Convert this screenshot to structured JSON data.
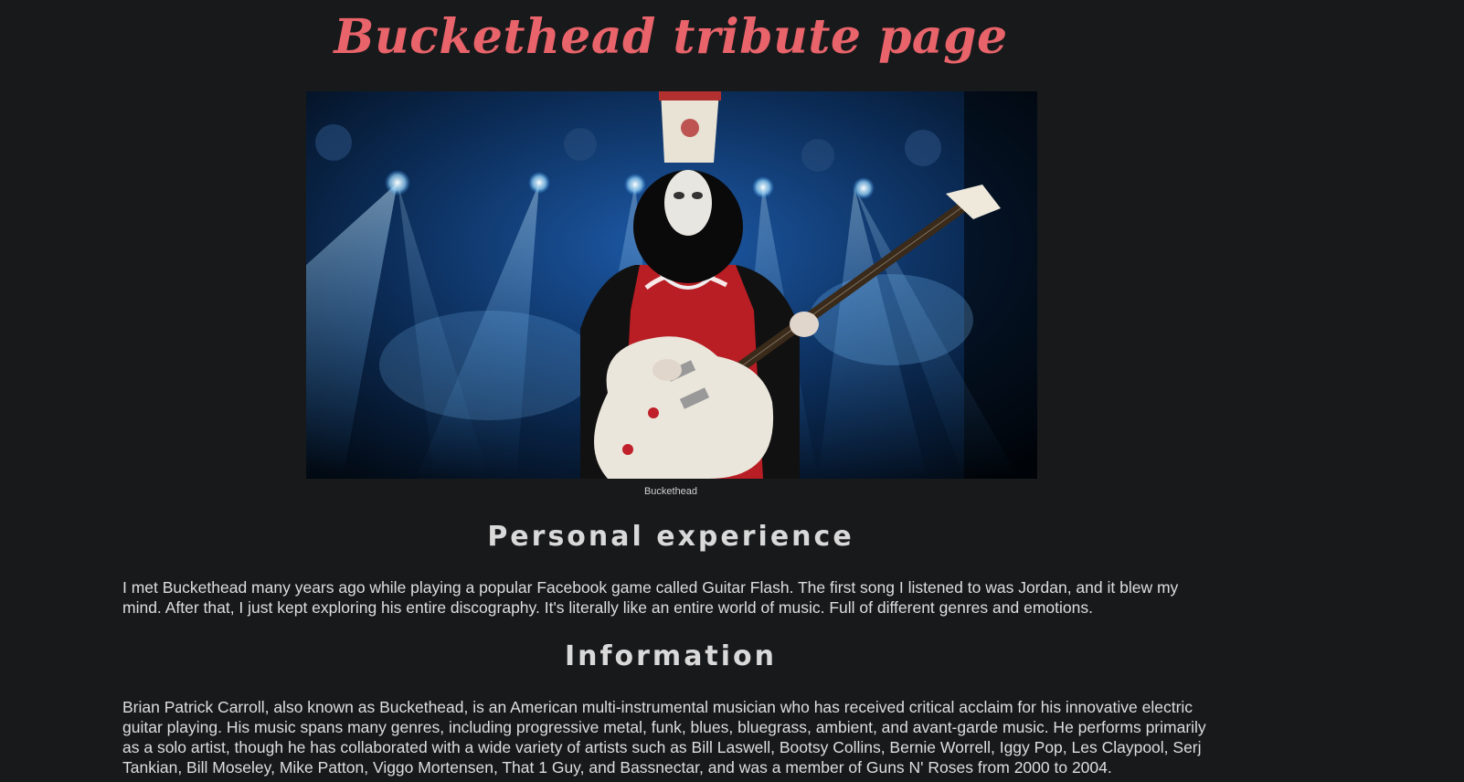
{
  "page": {
    "title": "Buckethead tribute page",
    "image_alt": "Buckethead",
    "caption": "Buckethead"
  },
  "sections": {
    "personal": {
      "heading": "Personal experience",
      "text": "I met Buckethead many years ago while playing a popular Facebook game called Guitar Flash. The first song I listened to was Jordan, and it blew my mind. After that, I just kept exploring his entire discography. It's literally like an entire world of music. Full of different genres and emotions."
    },
    "information": {
      "heading": "Information",
      "text": "Brian Patrick Carroll, also known as Buckethead, is an American multi-instrumental musician who has received critical acclaim for his innovative electric guitar playing. His music spans many genres, including progressive metal, funk, blues, bluegrass, ambient, and avant-garde music. He performs primarily as a solo artist, though he has collaborated with a wide variety of artists such as Bill Laswell, Bootsy Collins, Bernie Worrell, Iggy Pop, Les Claypool, Serj Tankian, Bill Moseley, Mike Patton, Viggo Mortensen, That 1 Guy, and Bassnectar, and was a member of Guns N' Roses from 2000 to 2004."
    }
  },
  "colors": {
    "background": "#18191b",
    "title": "#e8636a",
    "heading": "#d9d9d9",
    "text": "#dedede"
  }
}
